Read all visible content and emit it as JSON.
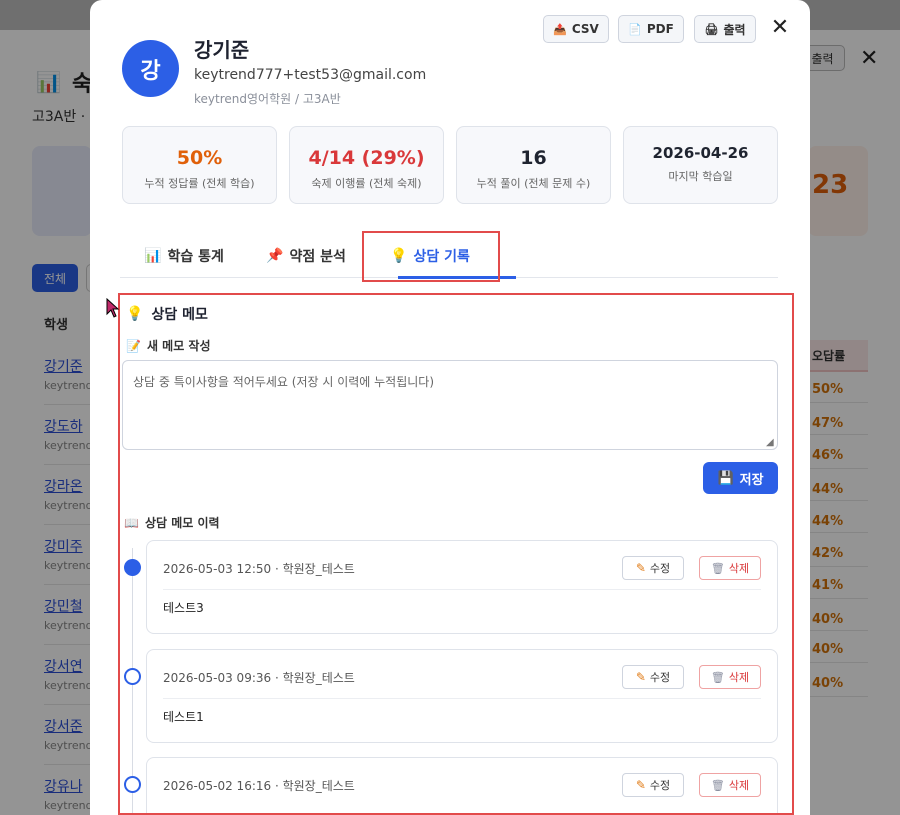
{
  "background_page": {
    "title_icon": "bar-chart-icon",
    "title": "숙",
    "subtitle": "고3A반 ·",
    "print_label": "출력",
    "big_number": "23",
    "filter_all_label": "전체",
    "column_student": "학생",
    "column_wrong_rate": "오답률",
    "students": [
      {
        "name": "강기준",
        "email": "keytrend",
        "rate": "50%"
      },
      {
        "name": "강도하",
        "email": "keytrend",
        "rate": "47%"
      },
      {
        "name": "강라온",
        "email": "keytrend",
        "rate": "46%"
      },
      {
        "name": "강미주",
        "email": "keytrend",
        "rate": "44%"
      },
      {
        "name": "강민철",
        "email": "keytrend",
        "rate": "44%"
      },
      {
        "name": "강서연",
        "email": "keytrend",
        "rate": "42%"
      },
      {
        "name": "강서준",
        "email": "keytrend",
        "rate": "41%"
      },
      {
        "name": "강유나",
        "email": "keytrend",
        "rate": "40%"
      }
    ],
    "extra_rates": [
      "40%",
      "40%"
    ]
  },
  "modal": {
    "avatar_initial": "강",
    "student_name": "강기준",
    "student_email": "keytrend777+test53@gmail.com",
    "student_org": "keytrend영어학원 / 고3A반",
    "toolbar": {
      "csv_label": "CSV",
      "pdf_label": "PDF",
      "print_label": "출력",
      "close_glyph": "✕"
    },
    "stats": [
      {
        "value": "50%",
        "label": "누적 정답률 (전체 학습)",
        "color": "#e0600a"
      },
      {
        "value": "4/14 (29%)",
        "label": "숙제 이행률 (전체 숙제)",
        "color": "#d9383a"
      },
      {
        "value": "16",
        "label": "누적 풀이 (전체 문제 수)",
        "color": "#1e2230"
      },
      {
        "value": "2026-04-26",
        "label": "마지막 학습일",
        "color": "#1e2230"
      }
    ],
    "tabs": [
      {
        "icon": "bar-chart-icon",
        "label": "학습 통계"
      },
      {
        "icon": "pushpin-icon",
        "label": "약점 분석"
      },
      {
        "icon": "lightbulb-icon",
        "label": "상담 기록"
      }
    ],
    "active_tab": "상담 기록",
    "counsel": {
      "section_title": "상담 메모",
      "new_memo_title": "새 메모 작성",
      "memo_placeholder": "상담 중 특이사항을 적어두세요 (저장 시 이력에 누적됩니다)",
      "save_label": "저장",
      "history_title": "상담 메모 이력",
      "edit_label": "수정",
      "delete_label": "삭제",
      "entries": [
        {
          "meta": "2026-05-03 12:50 · 학원장_테스트",
          "body": "테스트3",
          "current": true
        },
        {
          "meta": "2026-05-03 09:36 · 학원장_테스트",
          "body": "테스트1",
          "current": false
        },
        {
          "meta": "2026-05-02 16:16 · 학원장_테스트",
          "body": "",
          "current": false
        }
      ]
    }
  },
  "colors": {
    "accent": "#2c5fe6",
    "highlight": "#e24b4b",
    "danger": "#d9383a",
    "warning": "#e0600a"
  }
}
